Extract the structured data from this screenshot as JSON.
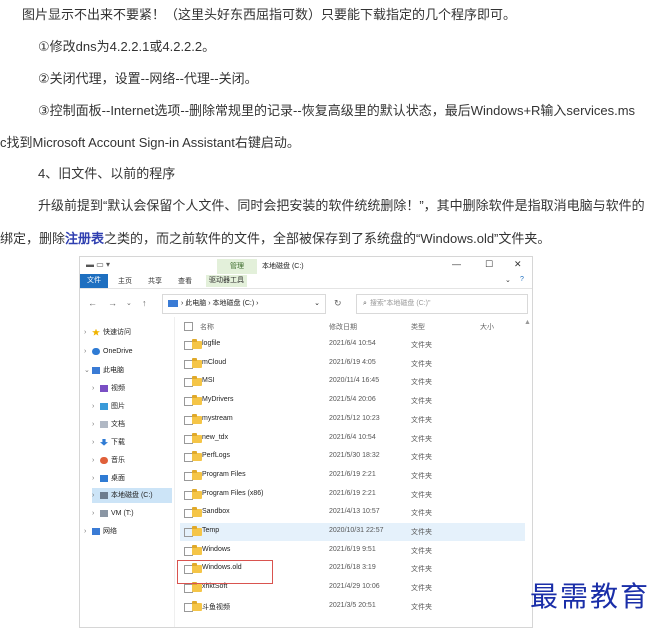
{
  "article": {
    "p1": "图片显示不出来不要紧！（这里头好东西屈指可数）只要能下载指定的几个程序即可。",
    "p2": "①修改dns为4.2.2.1或4.2.2.2。",
    "p3": "②关闭代理，设置--网络--代理--关闭。",
    "p4": "③控制面板--Internet选项--删除常规里的记录--恢复高级里的默认状态，最后Windows+R输入services.ms",
    "p5": "c找到Microsoft Account Sign-in Assistant右键启动。",
    "p6": "4、旧文件、以前的程序",
    "p7": "升级前提到“默认会保留个人文件、同时会把安装的软件统统删除！”，其中删除软件是指取消电脑与软件的",
    "p8_pre": "绑定，删除",
    "p8_link": "注册表",
    "p8_post": "之类的，而之前软件的文件，全部被保存到了系统盘的“Windows.old”文件夹。"
  },
  "explorer": {
    "title": "本地磁盘 (C:)",
    "manage_tab": "管理",
    "qat": "▬ ▭ ▾",
    "window_controls": {
      "minimize": "—",
      "maximize": "☐",
      "close": "✕"
    },
    "ribbon_tabs": {
      "file": "文件",
      "home": "主页",
      "share": "共享",
      "view": "查看",
      "drive_tools": "驱动器工具"
    },
    "ribbon_expand": "⌄",
    "help": "?",
    "nav": {
      "back": "←",
      "forward": "→",
      "recent": "⌄",
      "up": "↑"
    },
    "address": {
      "crumb1": "此电脑",
      "sep": "›",
      "crumb2": "本地磁盘 (C:)",
      "dropdown": "⌄"
    },
    "refresh": "↻",
    "search_placeholder": "搜索\"本地磁盘 (C:)\"",
    "columns": {
      "name": "名称",
      "date": "修改日期",
      "type": "类型",
      "size": "大小"
    },
    "sidebar": [
      {
        "label": "快速访问",
        "arrow": "›"
      },
      {
        "label": "OneDrive",
        "arrow": "›"
      },
      {
        "label": "此电脑",
        "arrow": "⌄"
      },
      {
        "label": "视频",
        "arrow": "›"
      },
      {
        "label": "图片",
        "arrow": "›"
      },
      {
        "label": "文档",
        "arrow": "›"
      },
      {
        "label": "下载",
        "arrow": "›"
      },
      {
        "label": "音乐",
        "arrow": "›"
      },
      {
        "label": "桌面",
        "arrow": "›"
      },
      {
        "label": "本地磁盘 (C:)",
        "arrow": "›"
      },
      {
        "label": "VM (T:)",
        "arrow": "›"
      },
      {
        "label": "网络",
        "arrow": "›"
      }
    ],
    "files": [
      {
        "name": "logfile",
        "date": "2021/6/4 10:54",
        "type": "文件夹"
      },
      {
        "name": "mCloud",
        "date": "2021/6/19 4:05",
        "type": "文件夹"
      },
      {
        "name": "MSI",
        "date": "2020/11/4 16:45",
        "type": "文件夹"
      },
      {
        "name": "MyDrivers",
        "date": "2021/5/4 20:06",
        "type": "文件夹"
      },
      {
        "name": "mystream",
        "date": "2021/5/12 10:23",
        "type": "文件夹"
      },
      {
        "name": "new_tdx",
        "date": "2021/6/4 10:54",
        "type": "文件夹"
      },
      {
        "name": "PerfLogs",
        "date": "2021/5/30 18:32",
        "type": "文件夹"
      },
      {
        "name": "Program Files",
        "date": "2021/6/19 2:21",
        "type": "文件夹"
      },
      {
        "name": "Program Files (x86)",
        "date": "2021/6/19 2:21",
        "type": "文件夹"
      },
      {
        "name": "Sandbox",
        "date": "2021/4/13 10:57",
        "type": "文件夹"
      },
      {
        "name": "Temp",
        "date": "2020/10/31 22:57",
        "type": "文件夹"
      },
      {
        "name": "Windows",
        "date": "2021/6/19 9:51",
        "type": "文件夹"
      },
      {
        "name": "Windows.old",
        "date": "2021/6/18 3:19",
        "type": "文件夹"
      },
      {
        "name": "xhktSoft",
        "date": "2021/4/29 10:06",
        "type": "文件夹"
      },
      {
        "name": "斗鱼视频",
        "date": "2021/3/5 20:51",
        "type": "文件夹"
      }
    ]
  },
  "watermark": "最需教育",
  "colors": {
    "accent": "#1e6fc0",
    "link": "#2f3fb0",
    "folder": "#f5c547",
    "highlight": "#d9534f",
    "watermark": "#1a2ea8"
  }
}
